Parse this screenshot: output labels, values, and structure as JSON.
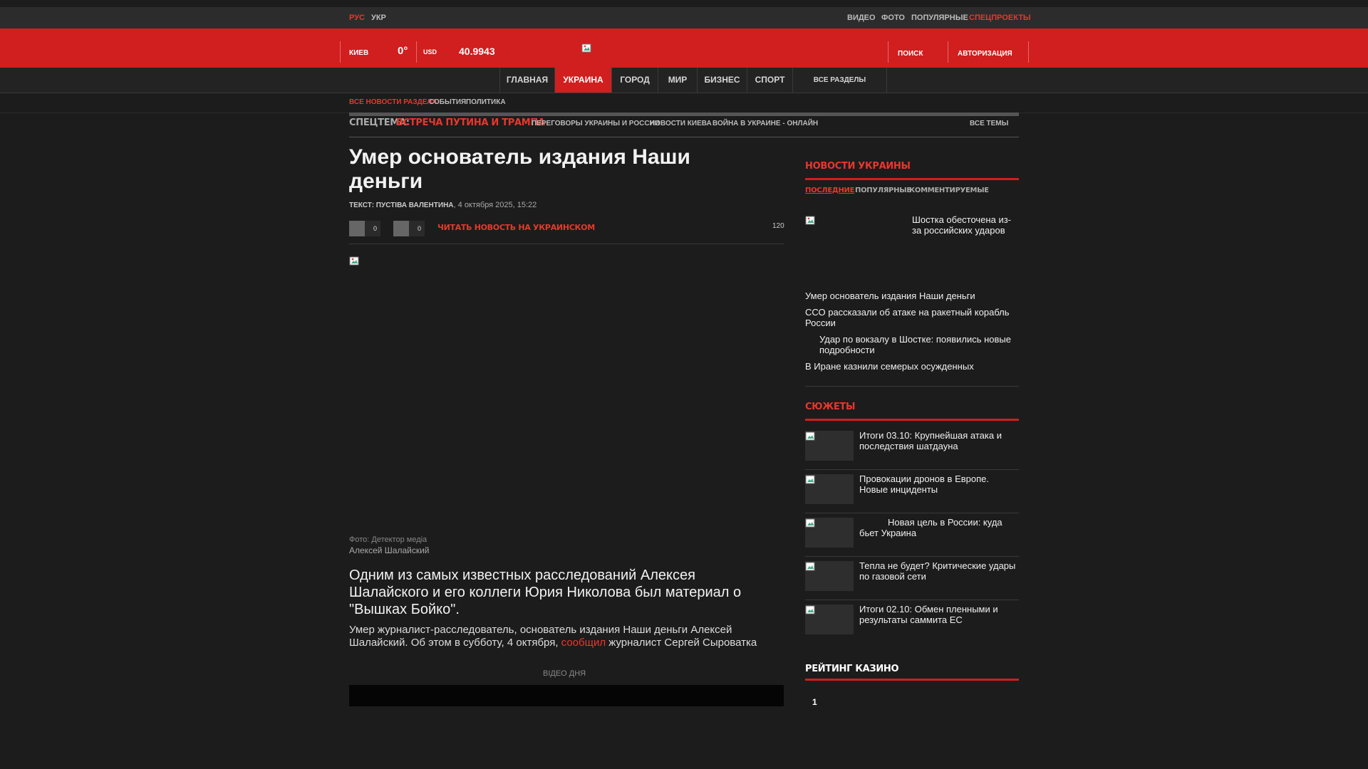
{
  "topbar": {
    "lang_ru": "РУС",
    "lang_uk": "УКР",
    "video": "ВИДЕО",
    "photo": "ФОТО",
    "popular": "ПОПУЛЯРНЫЕ",
    "specprojects": "СПЕЦПРОЕКТЫ"
  },
  "header": {
    "city": "КИЕВ",
    "temp": "0°",
    "currency": "USD",
    "rate": "40.9943",
    "search": "ПОИСК",
    "auth": "АВТОРИЗАЦИЯ"
  },
  "nav": {
    "items": [
      {
        "label": "ГЛАВНАЯ"
      },
      {
        "label": "УКРАИНА"
      },
      {
        "label": "ГОРОД"
      },
      {
        "label": "МИР"
      },
      {
        "label": "БИЗНЕС"
      },
      {
        "label": "СПОРТ"
      }
    ],
    "all_sections": "ВСЕ РАЗДЕЛЫ"
  },
  "subnav": {
    "all_news": "ВСЕ НОВОСТИ РАЗДЕЛА",
    "events": "СОБЫТИЯ",
    "politics": "ПОЛИТИКА"
  },
  "spectema": {
    "label": "СПЕЦТЕМА:",
    "topic": "ВСТРЕЧА ПУТИНА И ТРАМПА",
    "links": [
      "ПЕРЕГОВОРЫ УКРАИНЫ И РОССИИ",
      "НОВОСТИ КИЕВА",
      "ВОЙНА В УКРАИНЕ - ОНЛАЙН"
    ],
    "all_topics": "ВСЕ ТЕМЫ"
  },
  "article": {
    "title": "Умер основатель издания Наши деньги",
    "author": "ТЕКСТ: ПУСТІВА ВАЛЕНТИНА",
    "date": "4 октября 2025, 15:22",
    "share_count_1": "0",
    "share_count_2": "0",
    "read_ukrainian": "ЧИТАТЬ НОВОСТЬ НА УКРАИНСКОМ",
    "views": "120",
    "photo_credit": "Фото: Детектор медіа",
    "photo_caption": "Алексей Шалайский",
    "lead": "Одним из самых известных расследований Алексея Шалайского и его коллеги Юрия Николова был материал о \"Вышках Бойко\".",
    "body_part1": "Умер журналист-расследователь, основатель издания Наши деньги Алексей Шалайский. Об этом в субботу, 4 октября,",
    "body_link": "сообщил",
    "body_part2": "журналист Сергей Сыроватка",
    "video_of_day": "ВІДЕО ДНЯ"
  },
  "sidebar": {
    "news_title": "НОВОСТИ УКРАИНЫ",
    "tabs": [
      "ПОСЛЕДНИЕ",
      "ПОПУЛЯРНЫЕ",
      "КОММЕНТИРУЕМЫЕ"
    ],
    "featured": "Шостка обесточена из-за российских ударов",
    "news": [
      "Умер основатель издания Наши деньги",
      "ССО рассказали об атаке на ракетный корабль России",
      "Удар по вокзалу в Шостке: появились новые подробности",
      "В Иране казнили семерых осужденных"
    ],
    "stories_title": "СЮЖЕТЫ",
    "stories": [
      "Итоги 03.10: Крупнейшая атака и последствия шатдауна",
      "Провокации дронов в Европе. Новые инциденты",
      "Новая цель в России: куда бьет Украина",
      "Тепла не будет? Критические удары по газовой сети",
      "Итоги 02.10: Обмен пленными и результаты саммита ЕС"
    ],
    "casino_title": "РЕЙТИНГ КАЗИНО",
    "casino_rank": "1"
  },
  "colors": {
    "brand_red": "#d11e1e",
    "link_red": "#e8372c",
    "background": "#1c1c1c"
  },
  "icons": {
    "logo": "broken-image-icon",
    "share_1": "facebook-share-icon",
    "share_2": "telegram-share-icon"
  }
}
